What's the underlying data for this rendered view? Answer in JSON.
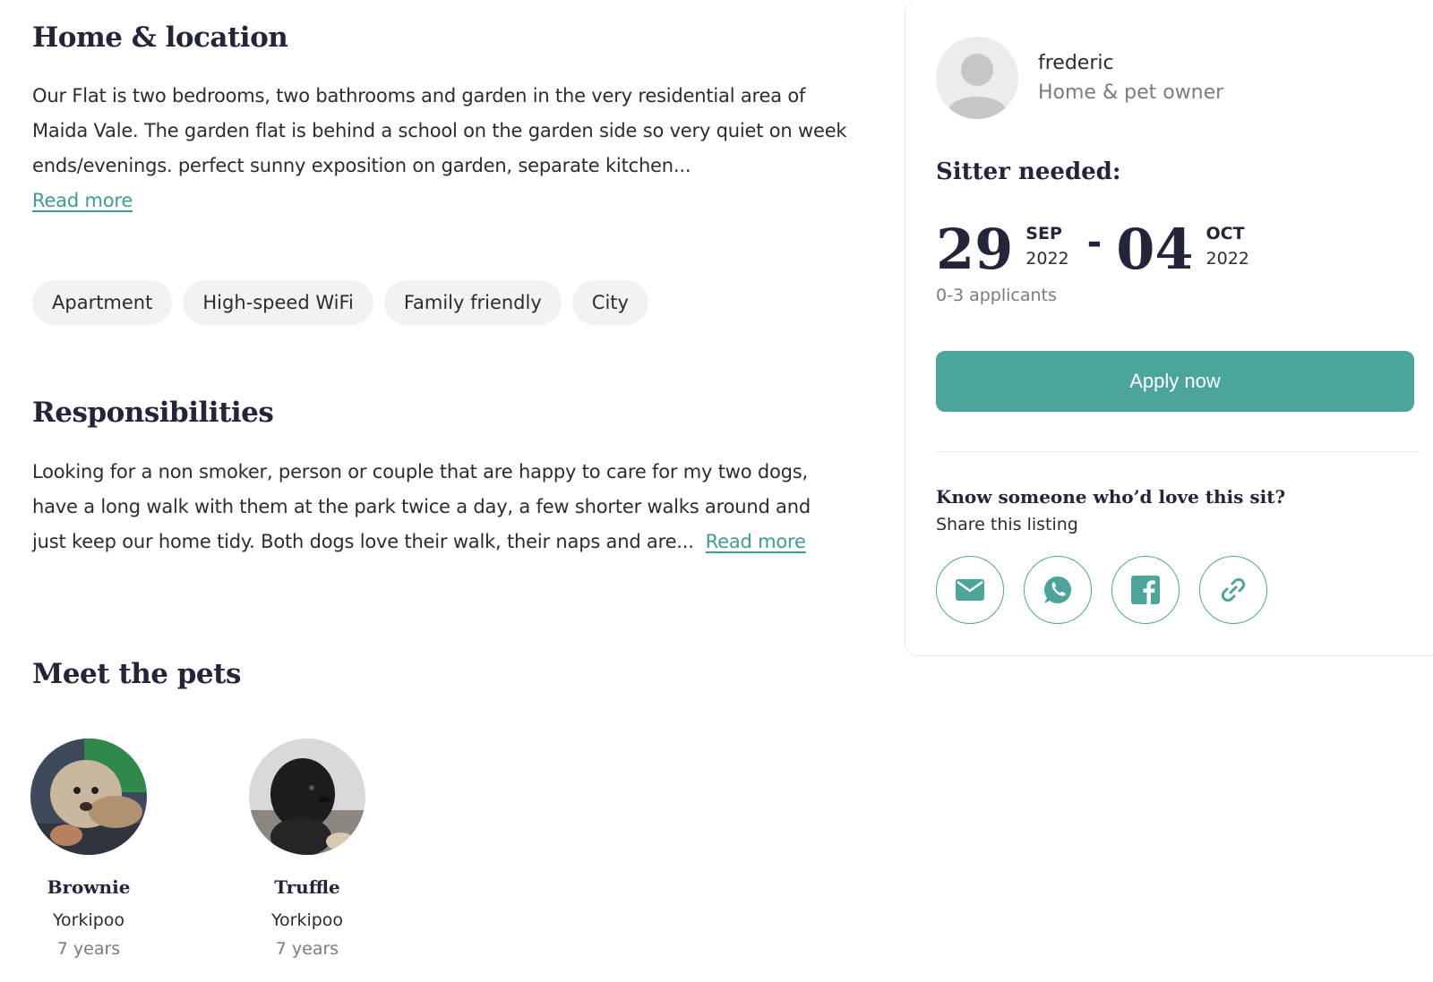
{
  "home": {
    "title": "Home & location",
    "text": "Our Flat is two bedrooms, two bathrooms and garden in the very residential area of Maida Vale. The garden flat is behind a school on the garden side so very quiet on week ends/evenings. perfect sunny exposition on garden, separate kitchen...",
    "read_more": "Read more"
  },
  "chips": [
    "Apartment",
    "High-speed WiFi",
    "Family friendly",
    "City"
  ],
  "responsibilities": {
    "title": "Responsibilities",
    "text": "Looking for a non smoker, person or couple that are happy to care for my two dogs, have a long walk with them at the park twice a day, a few shorter walks around and just keep our home tidy. Both dogs love their walk, their naps and are...",
    "read_more": "Read more"
  },
  "pets": {
    "title": "Meet the pets",
    "items": [
      {
        "name": "Brownie",
        "breed": "Yorkipoo",
        "age": "7 years"
      },
      {
        "name": "Truffle",
        "breed": "Yorkipoo",
        "age": "7 years"
      }
    ]
  },
  "sidebar": {
    "owner_name": "frederic",
    "owner_role": "Home & pet owner",
    "sitter_title": "Sitter needed:",
    "start": {
      "day": "29",
      "month": "SEP",
      "year": "2022"
    },
    "dash": "-",
    "end": {
      "day": "04",
      "month": "OCT",
      "year": "2022"
    },
    "applicants": "0-3 applicants",
    "apply_label": "Apply now",
    "share_title": "Know someone who’d love this sit?",
    "share_sub": "Share this listing",
    "share_icons": [
      "mail-icon",
      "whatsapp-icon",
      "facebook-icon",
      "link-icon"
    ]
  },
  "colors": {
    "accent": "#4ba59b",
    "link": "#3f9c92",
    "heading": "#23263a"
  }
}
